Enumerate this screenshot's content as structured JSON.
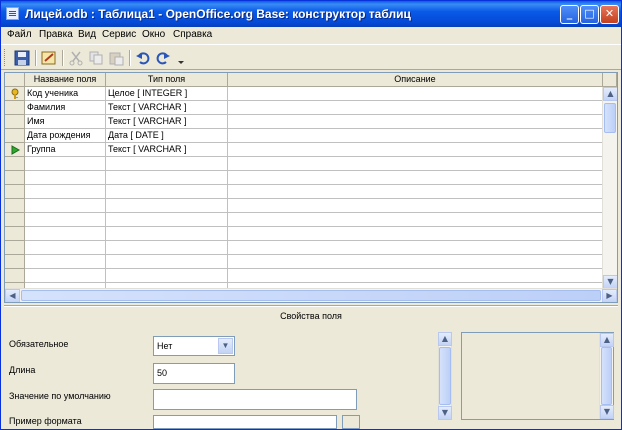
{
  "window": {
    "title": "Лицей.odb : Таблица1 - OpenOffice.org Base: конструктор таблиц",
    "minimize": "_",
    "maximize": "□",
    "close": "✕"
  },
  "menu": [
    "Файл",
    "Правка",
    "Вид",
    "Сервис",
    "Окно",
    "Справка"
  ],
  "toolbar": {
    "icons": [
      "save-icon",
      "edit-icon",
      "cut-icon",
      "copy-icon",
      "paste-icon",
      "undo-icon",
      "redo-icon",
      "toolbar-options-icon"
    ]
  },
  "table": {
    "columns": [
      "Название поля",
      "Тип поля",
      "Описание"
    ],
    "rows": [
      {
        "name": "Код ученика",
        "type": "Целое [ INTEGER ]",
        "description": "",
        "marker": "key"
      },
      {
        "name": "Фамилия",
        "type": "Текст [ VARCHAR ]",
        "description": "",
        "marker": ""
      },
      {
        "name": "Имя",
        "type": "Текст [ VARCHAR ]",
        "description": "",
        "marker": ""
      },
      {
        "name": "Дата рождения",
        "type": "Дата [ DATE ]",
        "description": "",
        "marker": ""
      },
      {
        "name": "Группа",
        "type": "Текст [ VARCHAR ]",
        "description": "",
        "marker": "current"
      }
    ],
    "empty_rows": 10
  },
  "properties": {
    "title": "Свойства поля",
    "required_label": "Обязательное",
    "required_value": "Нет",
    "length_label": "Длина",
    "length_value": "50",
    "default_label": "Значение по умолчанию",
    "default_value": "",
    "format_label": "Пример формата"
  },
  "colors": {
    "titlebar": "#0a5ae8",
    "window_bg": "#ece9d8",
    "border": "#7f9db9"
  }
}
